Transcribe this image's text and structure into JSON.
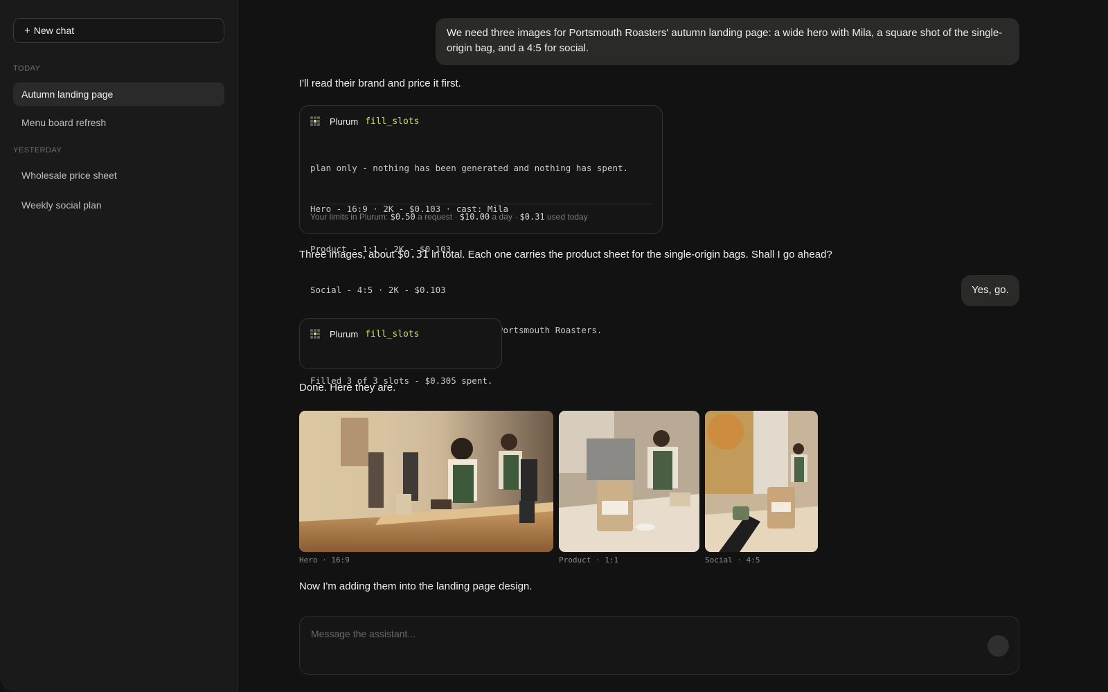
{
  "sidebar": {
    "new_chat_icon": "+",
    "new_chat_label": "New chat",
    "sections": [
      {
        "label": "TODAY",
        "items": [
          {
            "label": "Autumn landing page",
            "active": true
          },
          {
            "label": "Menu board refresh",
            "active": false
          }
        ]
      },
      {
        "label": "YESTERDAY",
        "items": [
          {
            "label": "Wholesale price sheet",
            "active": false
          },
          {
            "label": "Weekly social plan",
            "active": false
          }
        ]
      }
    ]
  },
  "chat": {
    "user_msg_1": "We need three images for Portsmouth Roasters' autumn landing page: a wide hero with Mila, a square shot of the single-origin bag, and a 4:5 for social.",
    "assistant_msg_1": "I'll read their brand and price it first.",
    "tool_call_1": {
      "tool": "Plurum",
      "function": "fill_slots",
      "lines": [
        "plan only - nothing has been generated and nothing has spent.",
        "Hero - 16:9 · 2K - $0.103 · cast: Mila",
        "Product - 1:1 · 2K - $0.103",
        "Social - 4:5 · 2K - $0.103",
        "3 slots, about $0.309 in total, for Portsmouth Roasters."
      ],
      "limits": {
        "prefix": "Your limits in Plurum:",
        "per_request": "$0.50",
        "per_request_label": "a request ·",
        "per_day": "$10.00",
        "per_day_label": "a day ·",
        "used": "$0.31",
        "used_label": "used today"
      }
    },
    "assistant_msg_2": {
      "before": "Three images, about",
      "amount": "$0.31",
      "after": "in total. Each one carries the product sheet for the single-origin bags. Shall I go ahead?"
    },
    "user_msg_2": "Yes, go.",
    "tool_call_2": {
      "tool": "Plurum",
      "function": "fill_slots",
      "lines": [
        "Filled 3 of 3 slots - $0.305 spent."
      ]
    },
    "assistant_msg_3": "Done. Here they are.",
    "images": [
      {
        "caption": "Hero · 16:9",
        "alt": "Barista pouring coffee at a wooden counter in a café"
      },
      {
        "caption": "Product · 1:1",
        "alt": "Portsmouth Roasters coffee bag on a café counter"
      },
      {
        "caption": "Social · 4:5",
        "alt": "Customer holding a cup beside a coffee bag in a café"
      }
    ],
    "assistant_msg_4": "Now I'm adding them into the landing page design."
  },
  "composer": {
    "placeholder": "Message the assistant..."
  },
  "colors": {
    "background": "#121212",
    "sidebar": "#1a1a1a",
    "accent_function": "#c8e06a",
    "user_bubble": "#2a2a28"
  }
}
